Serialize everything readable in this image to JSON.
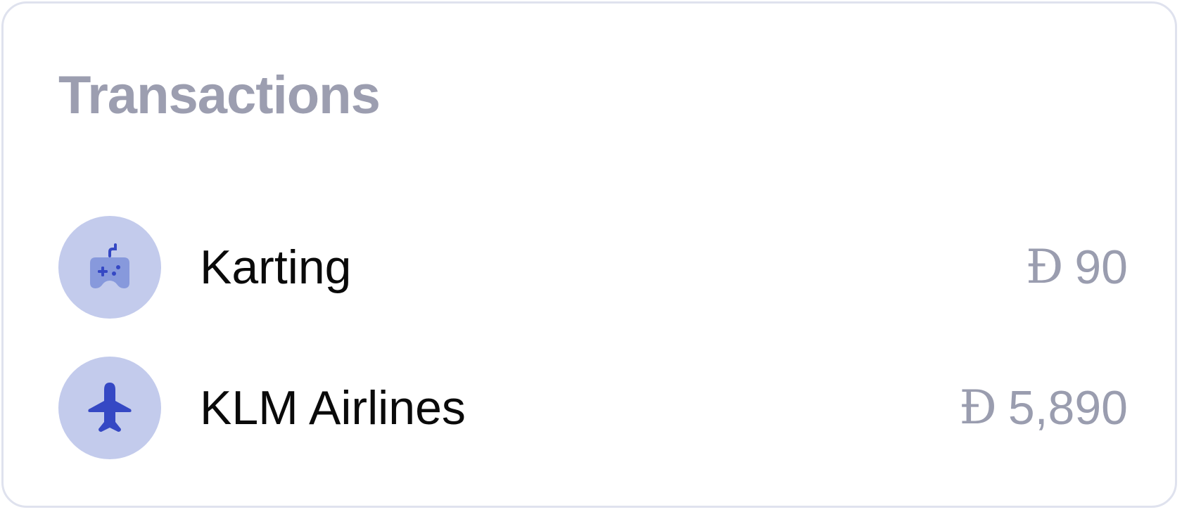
{
  "card": {
    "title": "Transactions"
  },
  "transactions": [
    {
      "icon": "gamepad-icon",
      "name": "Karting",
      "currency_symbol": "Ð",
      "amount": "90"
    },
    {
      "icon": "airplane-icon",
      "name": "KLM Airlines",
      "currency_symbol": "Ð",
      "amount": "5,890"
    }
  ],
  "colors": {
    "title": "#9c9eb0",
    "avatar_bg": "#c3cbec",
    "icon_primary": "#3548c4",
    "icon_secondary": "#8799dc",
    "amount": "#9a9daf",
    "border": "#dfe2ee"
  }
}
